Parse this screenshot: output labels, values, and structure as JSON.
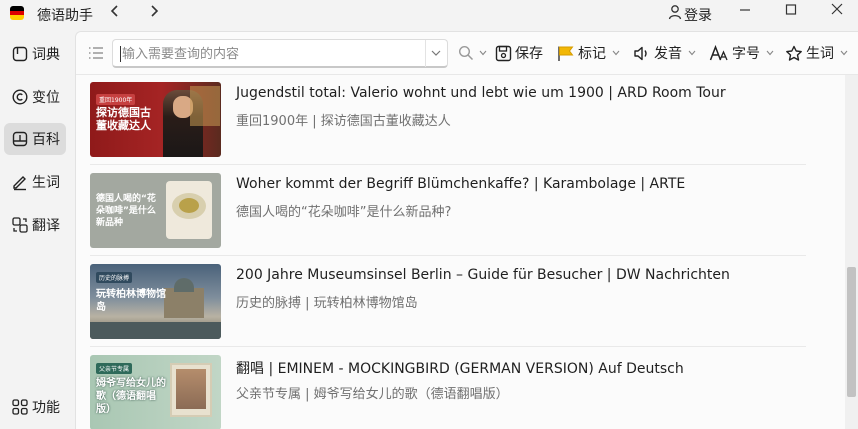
{
  "window": {
    "app_title": "德语助手",
    "login_label": "登录"
  },
  "sidebar": {
    "items": [
      {
        "label": "词典",
        "icon": "book-icon"
      },
      {
        "label": "变位",
        "icon": "conjugation-icon"
      },
      {
        "label": "百科",
        "icon": "encyclopedia-icon",
        "active": true
      },
      {
        "label": "生词",
        "icon": "pencil-icon"
      },
      {
        "label": "翻译",
        "icon": "translate-icon"
      }
    ],
    "bottom_label": "功能"
  },
  "toolbar": {
    "search_placeholder": "输入需要查询的内容",
    "save_label": "保存",
    "mark_label": "标记",
    "pronounce_label": "发音",
    "font_label": "字号",
    "vocab_label": "生词"
  },
  "articles": [
    {
      "title": "Jugendstil total: Valerio wohnt und lebt wie um 1900 | ARD Room Tour",
      "subtitle": "重回1900年 | 探访德国古董收藏达人",
      "thumb_badge": "重回1900年",
      "thumb_text": "探访德国古董收藏达人"
    },
    {
      "title": "Woher kommt der Begriff Blümchenkaffe? | Karambolage | ARTE",
      "subtitle": "德国人喝的“花朵咖啡”是什么新品种?",
      "thumb_text": "德国人喝的“花朵咖啡”是什么新品种"
    },
    {
      "title": "200 Jahre Museumsinsel Berlin – Guide für Besucher | DW Nachrichten",
      "subtitle": "历史的脉搏 | 玩转柏林博物馆岛",
      "thumb_badge": "历史的脉搏",
      "thumb_text": "玩转柏林博物馆岛"
    },
    {
      "title": "翻唱 | EMINEM - MOCKINGBIRD (GERMAN VERSION) Auf Deutsch",
      "subtitle": "父亲节专属 | 姆爷写给女儿的歌（德语翻唱版）",
      "thumb_badge": "父亲节专属",
      "thumb_text": "姆爷写给女儿的歌（德语翻唱版）"
    }
  ],
  "colors": {
    "flag_black": "#000000",
    "flag_red": "#dd0000",
    "flag_gold": "#ffce00",
    "mark_flag": "#f2b705"
  }
}
